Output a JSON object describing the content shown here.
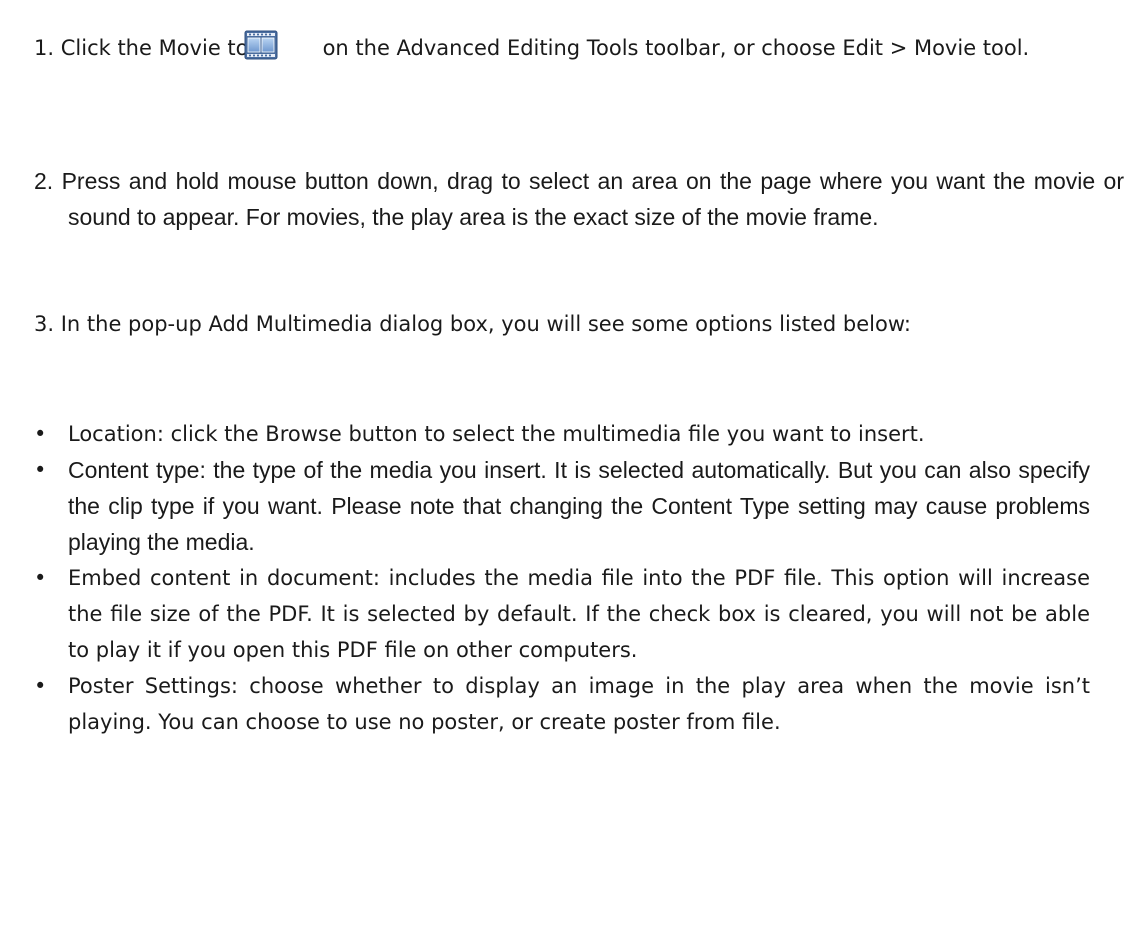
{
  "steps": {
    "step1": {
      "number": "1.",
      "before_icon": "Click the Movie tool",
      "icon": "movie-film-icon",
      "after_icon": "on the Advanced Editing Tools toolbar, or choose Edit > Movie tool."
    },
    "step2": {
      "number": "2.",
      "text": "Press and hold mouse button down, drag to select an area on the page where you want the movie or sound to appear. For movies, the play area is the exact size of the movie frame."
    },
    "step3": {
      "number": "3.",
      "text": "In the pop-up Add Multimedia dialog box, you will see some options listed below:"
    }
  },
  "bullet_symbol": "•",
  "options": [
    "Location: click the Browse button to select the multimedia file you want to insert.",
    "Content type: the type of the media you insert. It is selected automatically. But you can also specify the clip type if you want. Please note that changing the Content Type setting may cause problems playing the media.",
    "Embed content in document: includes the media file into the PDF file. This option will increase the file size of the PDF. It is selected by default. If the check box is cleared, you will not be able to play it if you open this PDF file on other computers.",
    "Poster Settings: choose whether to display an image in the play area when the movie isn’t playing. You can choose to use no poster, or create poster from file."
  ],
  "colors": {
    "text": "#1a1a1a",
    "icon_frame": "#3a5a8c",
    "icon_fill": "#8db4e2"
  }
}
